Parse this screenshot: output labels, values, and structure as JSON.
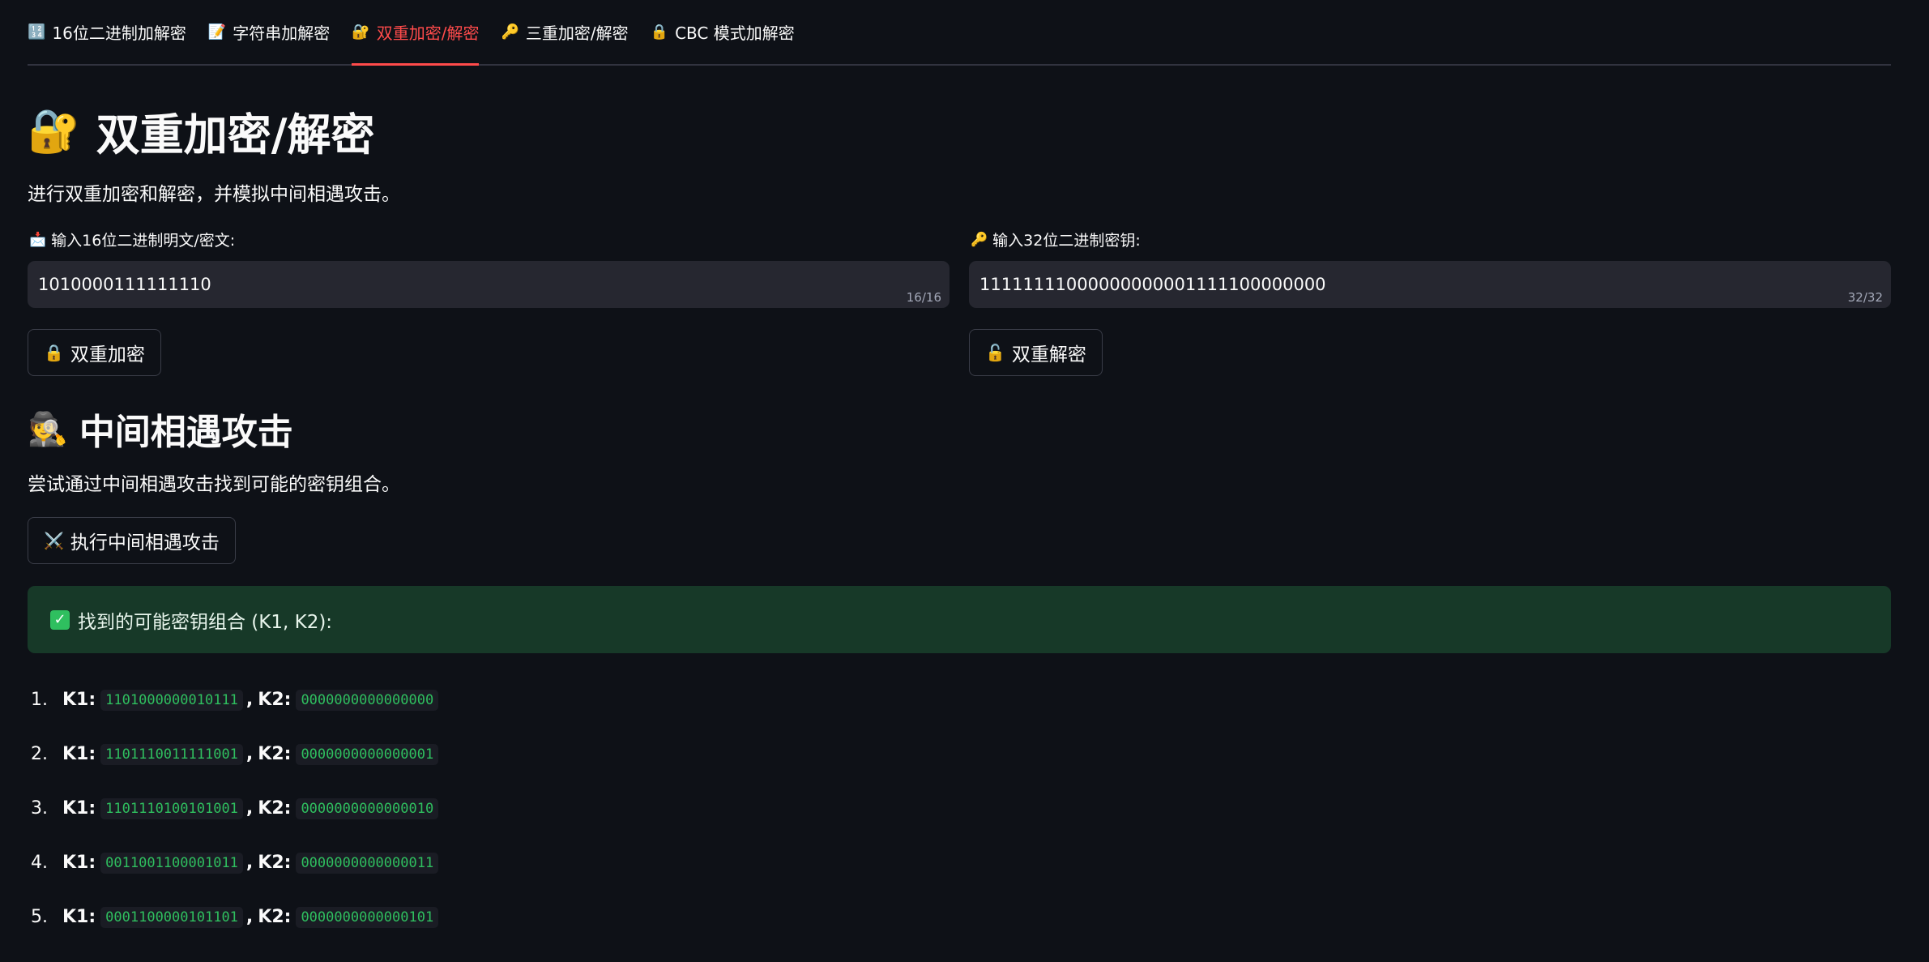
{
  "tabs": [
    {
      "icon": "🔢",
      "label": "16位二进制加解密"
    },
    {
      "icon": "📝",
      "label": "字符串加解密"
    },
    {
      "icon": "🔐",
      "label": "双重加密/解密"
    },
    {
      "icon": "🔑",
      "label": "三重加密/解密"
    },
    {
      "icon": "🔒",
      "label": "CBC 模式加解密"
    }
  ],
  "page": {
    "title_icon": "🔐",
    "title": "双重加密/解密",
    "description": "进行双重加密和解密，并模拟中间相遇攻击。"
  },
  "plaintext": {
    "icon": "📩",
    "label": "输入16位二进制明文/密文:",
    "value": "1010000111111110",
    "counter": "16/16"
  },
  "key": {
    "icon": "🔑",
    "label": "输入32位二进制密钥:",
    "value": "11111111000000000001111100000000",
    "counter": "32/32"
  },
  "buttons": {
    "encrypt_icon": "🔒",
    "encrypt": "双重加密",
    "decrypt_icon": "🔓",
    "decrypt": "双重解密",
    "attack_icon": "⚔️",
    "attack": "执行中间相遇攻击"
  },
  "attack": {
    "icon": "🕵️",
    "title": "中间相遇攻击",
    "description": "尝试通过中间相遇攻击找到可能的密钥组合。",
    "result_label": "找到的可能密钥组合 (K1, K2):"
  },
  "results": [
    {
      "num": "1.",
      "k1_label": "K1:",
      "k1": "1101000000010111",
      "k2_label": "K2:",
      "k2": "0000000000000000"
    },
    {
      "num": "2.",
      "k1_label": "K1:",
      "k1": "1101110011111001",
      "k2_label": "K2:",
      "k2": "0000000000000001"
    },
    {
      "num": "3.",
      "k1_label": "K1:",
      "k1": "1101110100101001",
      "k2_label": "K2:",
      "k2": "0000000000000010"
    },
    {
      "num": "4.",
      "k1_label": "K1:",
      "k1": "0011001100001011",
      "k2_label": "K2:",
      "k2": "0000000000000011"
    },
    {
      "num": "5.",
      "k1_label": "K1:",
      "k1": "0001100000101101",
      "k2_label": "K2:",
      "k2": "0000000000000101"
    }
  ],
  "colors": {
    "background": "#0e1117",
    "accent": "#ff4b4b",
    "success_bg": "#173928",
    "code_green": "#2fbf5f",
    "input_bg": "#262730"
  }
}
